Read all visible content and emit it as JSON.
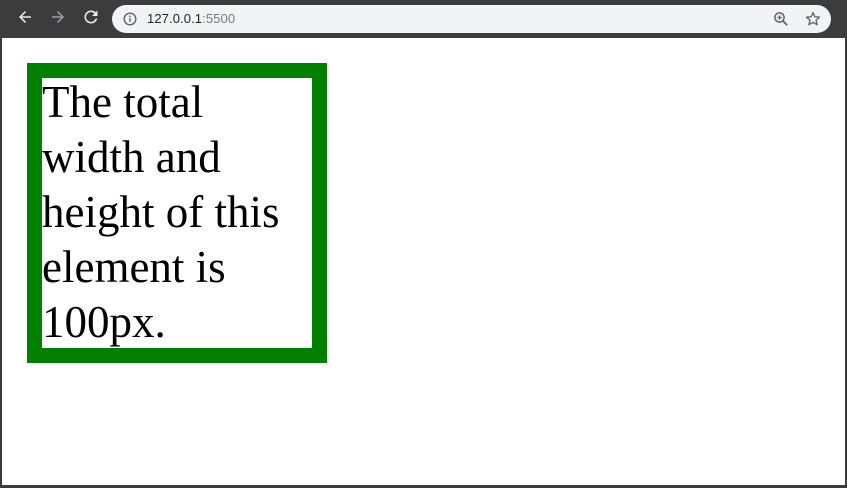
{
  "browser": {
    "url_host": "127.0.0.1",
    "url_port": ":5500",
    "icons": {
      "back": "arrow-left-icon",
      "forward": "arrow-right-icon",
      "reload": "reload-icon",
      "site_info": "info-icon",
      "zoom": "zoom-in-icon",
      "bookmark": "star-icon"
    },
    "colors": {
      "chrome_frame": "#3c3c3c",
      "omnibox_bg": "#f1f3f4"
    }
  },
  "page": {
    "box_text": "The total width and height of this element is 100px.",
    "colors": {
      "box_border": "#008000",
      "text": "#000000",
      "background": "#ffffff"
    }
  }
}
